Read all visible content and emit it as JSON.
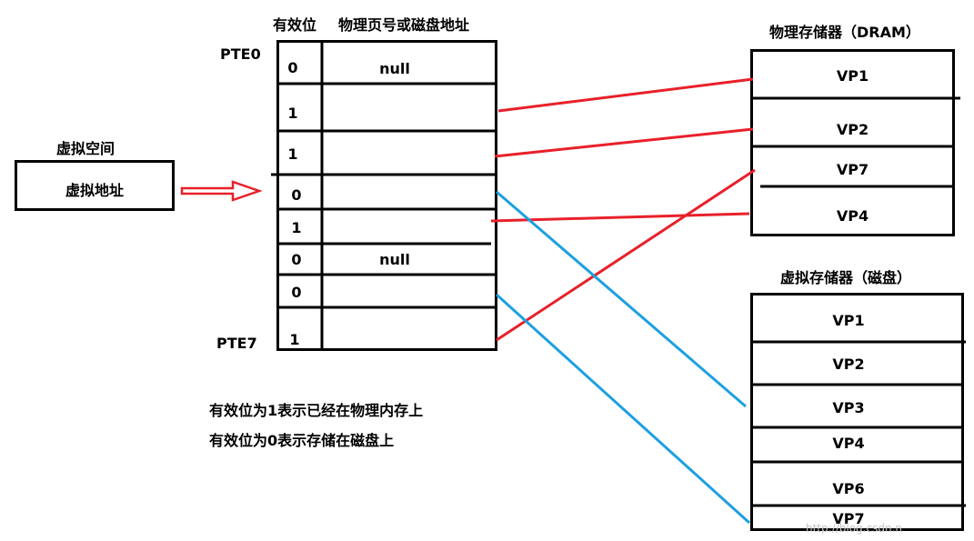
{
  "page_table": {
    "header_valid": "有效位",
    "header_addr": "物理页号或磁盘地址",
    "pte_first": "PTE0",
    "pte_last": "PTE7",
    "rows": [
      {
        "valid": "0",
        "addr": "null"
      },
      {
        "valid": "1",
        "addr": ""
      },
      {
        "valid": "1",
        "addr": ""
      },
      {
        "valid": "0",
        "addr": ""
      },
      {
        "valid": "1",
        "addr": ""
      },
      {
        "valid": "0",
        "addr": "null"
      },
      {
        "valid": "0",
        "addr": ""
      },
      {
        "valid": "1",
        "addr": ""
      }
    ]
  },
  "virtual_space": {
    "title": "虚拟空间",
    "box_label": "虚拟地址"
  },
  "dram": {
    "title": "物理存储器（DRAM）",
    "pages": [
      "VP1",
      "VP2",
      "VP7",
      "VP4"
    ]
  },
  "disk": {
    "title": "虚拟存储器（磁盘）",
    "pages": [
      "VP1",
      "VP2",
      "VP3",
      "VP4",
      "VP6",
      "VP7"
    ]
  },
  "notes": [
    "有效位为1表示已经在物理内存上",
    "有效位为0表示存储在磁盘上"
  ],
  "colors": {
    "dram_link": "#e8202a",
    "disk_link": "#1ea0e0",
    "arrow": "#e8202a"
  },
  "watermark": "http://blog.csdn.n"
}
